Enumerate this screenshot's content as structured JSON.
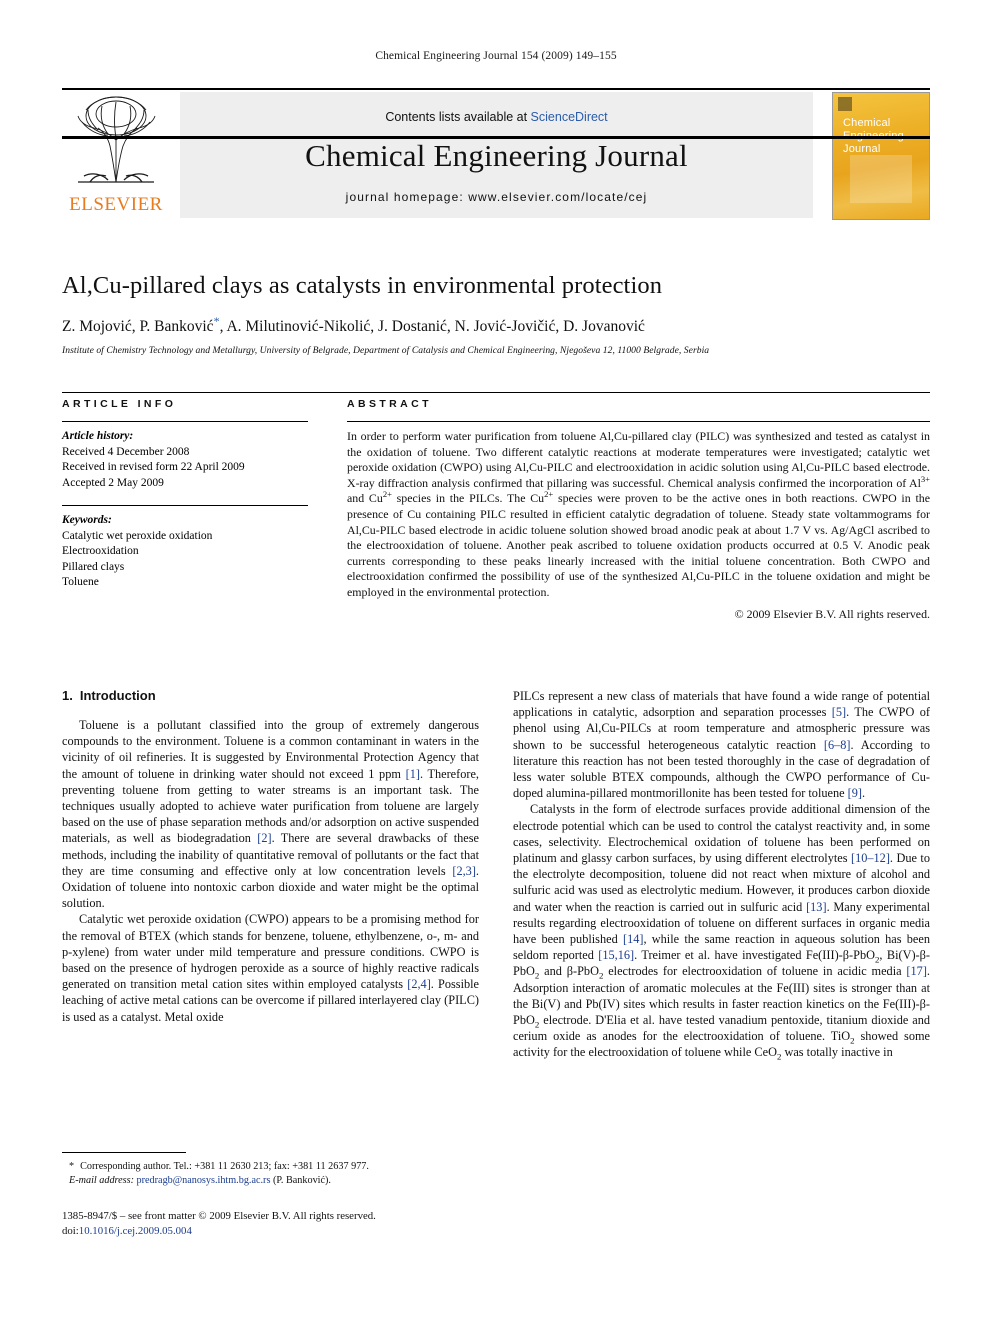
{
  "running_head": "Chemical Engineering Journal 154 (2009) 149–155",
  "masthead": {
    "contents_prefix": "Contents lists available at ",
    "sciencedirect": "ScienceDirect",
    "journal_title": "Chemical Engineering Journal",
    "homepage": "journal homepage: www.elsevier.com/locate/cej",
    "publisher": "ELSEVIER",
    "cover_title": "Chemical Engineering Journal",
    "accent_orange": "#E87B1E",
    "link_blue": "#2a5caa",
    "cover_gold": "#edb128"
  },
  "title_block": {
    "title": "Al,Cu-pillared clays as catalysts in environmental protection",
    "authors": "Z. Mojović, P. Banković",
    "authors_tail": ", A. Milutinović-Nikolić, J. Dostanić, N. Jović-Jovičić, D. Jovanović",
    "corresponding_marker": "*",
    "affiliation": "Institute of Chemistry Technology and Metallurgy, University of Belgrade, Department of Catalysis and Chemical Engineering, Njegoševa 12, 11000 Belgrade, Serbia"
  },
  "article_info": {
    "heading": "ARTICLE INFO",
    "history_label": "Article history:",
    "history": [
      "Received 4 December 2008",
      "Received in revised form 22 April 2009",
      "Accepted 2 May 2009"
    ],
    "keywords_label": "Keywords:",
    "keywords": [
      "Catalytic wet peroxide oxidation",
      "Electrooxidation",
      "Pillared clays",
      "Toluene"
    ]
  },
  "abstract": {
    "heading": "ABSTRACT",
    "text": "In order to perform water purification from toluene Al,Cu-pillared clay (PILC) was synthesized and tested as catalyst in the oxidation of toluene. Two different catalytic reactions at moderate temperatures were investigated; catalytic wet peroxide oxidation (CWPO) using Al,Cu-PILC and electrooxidation in acidic solution using Al,Cu-PILC based electrode. X-ray diffraction analysis confirmed that pillaring was successful. Chemical analysis confirmed the incorporation of Al3+ and Cu2+ species in the PILCs. The Cu2+ species were proven to be the active ones in both reactions. CWPO in the presence of Cu containing PILC resulted in efficient catalytic degradation of toluene. Steady state voltammograms for Al,Cu-PILC based electrode in acidic toluene solution showed broad anodic peak at about 1.7 V vs. Ag/AgCl ascribed to the electrooxidation of toluene. Another peak ascribed to toluene oxidation products occurred at 0.5 V. Anodic peak currents corresponding to these peaks linearly increased with the initial toluene concentration. Both CWPO and electrooxidation confirmed the possibility of use of the synthesized Al,Cu-PILC in the toluene oxidation and might be employed in the environmental protection.",
    "copyright": "© 2009 Elsevier B.V. All rights reserved."
  },
  "introduction": {
    "number": "1.",
    "title": "Introduction",
    "left_paragraphs": [
      "Toluene is a pollutant classified into the group of extremely dangerous compounds to the environment. Toluene is a common contaminant in waters in the vicinity of oil refineries. It is suggested by Environmental Protection Agency that the amount of toluene in drinking water should not exceed 1 ppm [1]. Therefore, preventing toluene from getting to water streams is an important task. The techniques usually adopted to achieve water purification from toluene are largely based on the use of phase separation methods and/or adsorption on active suspended materials, as well as biodegradation [2]. There are several drawbacks of these methods, including the inability of quantitative removal of pollutants or the fact that they are time consuming and effective only at low concentration levels [2,3]. Oxidation of toluene into nontoxic carbon dioxide and water might be the optimal solution.",
      "Catalytic wet peroxide oxidation (CWPO) appears to be a promising method for the removal of BTEX (which stands for benzene, toluene, ethylbenzene, o-, m- and p-xylene) from water under mild temperature and pressure conditions. CWPO is based on the presence of hydrogen peroxide as a source of highly reactive radicals generated on transition metal cation sites within employed catalysts [2,4]. Possible leaching of active metal cations can be overcome if pillared interlayered clay (PILC) is used as a catalyst. Metal oxide"
    ],
    "right_paragraphs": [
      "PILCs represent a new class of materials that have found a wide range of potential applications in catalytic, adsorption and separation processes [5]. The CWPO of phenol using Al,Cu-PILCs at room temperature and atmospheric pressure was shown to be successful heterogeneous catalytic reaction [6–8]. According to literature this reaction has not been tested thoroughly in the case of degradation of less water soluble BTEX compounds, although the CWPO performance of Cu-doped alumina-pillared montmorillonite has been tested for toluene [9].",
      "Catalysts in the form of electrode surfaces provide additional dimension of the electrode potential which can be used to control the catalyst reactivity and, in some cases, selectivity. Electrochemical oxidation of toluene has been performed on platinum and glassy carbon surfaces, by using different electrolytes [10–12]. Due to the electrolyte decomposition, toluene did not react when mixture of alcohol and sulfuric acid was used as electrolytic medium. However, it produces carbon dioxide and water when the reaction is carried out in sulfuric acid [13]. Many experimental results regarding electrooxidation of toluene on different surfaces in organic media have been published [14], while the same reaction in aqueous solution has been seldom reported [15,16]. Treimer et al. have investigated Fe(III)-β-PbO2, Bi(V)-β-PbO2 and β-PbO2 electrodes for electrooxidation of toluene in acidic media [17]. Adsorption interaction of aromatic molecules at the Fe(III) sites is stronger than at the Bi(V) and Pb(IV) sites which results in faster reaction kinetics on the Fe(III)-β-PbO2 electrode. D'Elia et al. have tested vanadium pentoxide, titanium dioxide and cerium oxide as anodes for the electrooxidation of toluene. TiO2 showed some activity for the electrooxidation of toluene while CeO2 was totally inactive in"
    ]
  },
  "footnote": {
    "star": "*",
    "corresponding": "Corresponding author. Tel.: +381 11 2630 213; fax: +381 11 2637 977.",
    "email_label": "E-mail address:",
    "email": "predragb@nanosys.ihtm.bg.ac.rs",
    "email_owner": "(P. Banković)."
  },
  "imprint": {
    "issn_line": "1385-8947/$ – see front matter © 2009 Elsevier B.V. All rights reserved.",
    "doi_label": "doi:",
    "doi": "10.1016/j.cej.2009.05.004"
  }
}
